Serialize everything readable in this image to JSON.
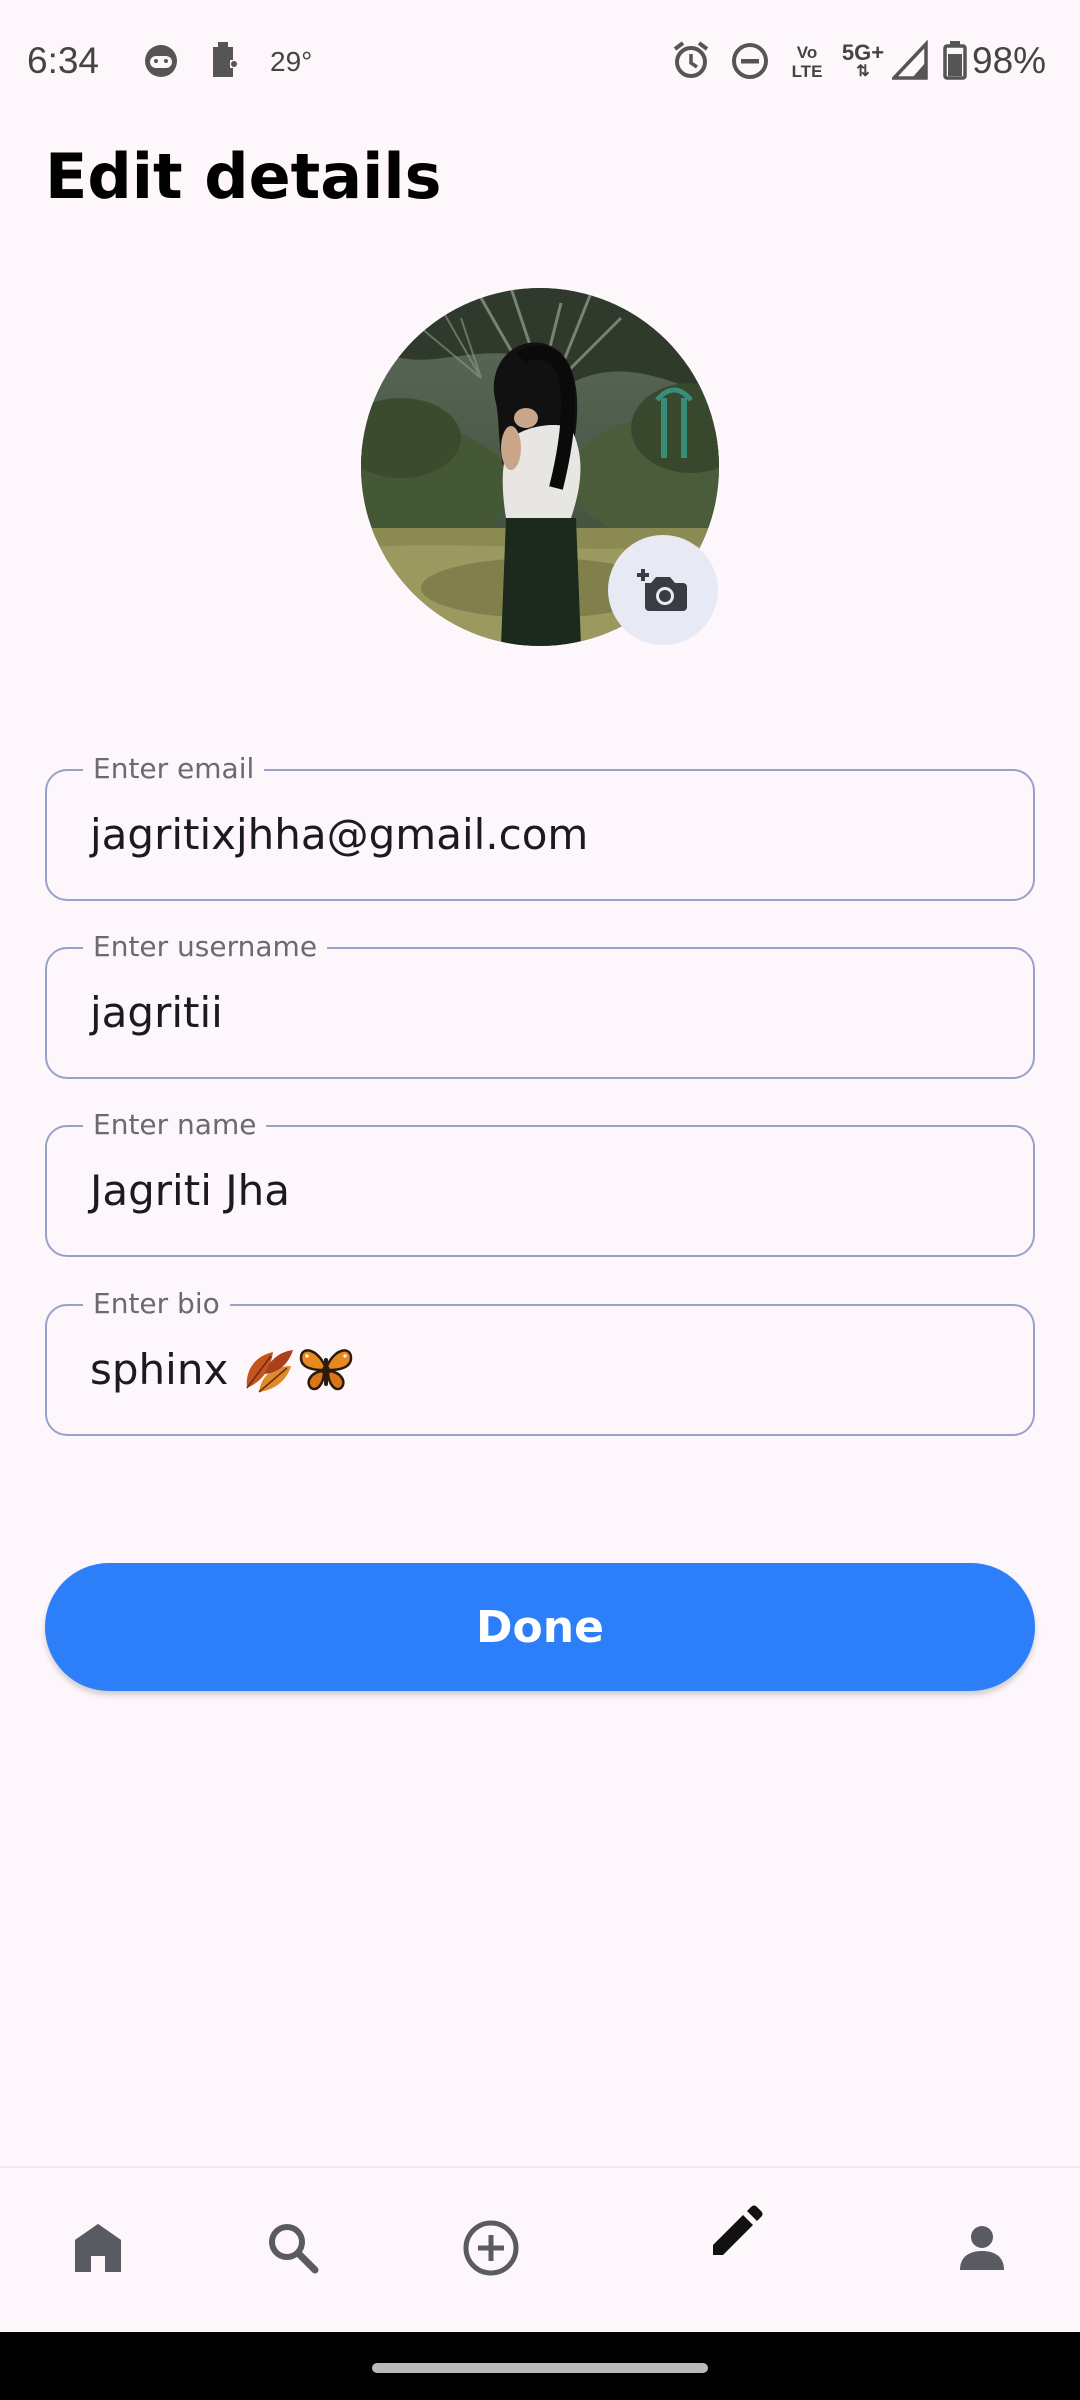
{
  "status_bar": {
    "time": "6:34",
    "temperature": "29°",
    "network_top": "Vo",
    "network_bottom": "LTE",
    "network_5g": "5G+",
    "battery": "98%"
  },
  "page": {
    "title": "Edit details"
  },
  "form": {
    "email": {
      "label": "Enter email",
      "value": "jagritixjhha@gmail.com"
    },
    "username": {
      "label": "Enter username",
      "value": "jagritii"
    },
    "name": {
      "label": "Enter name",
      "value": "Jagriti Jha"
    },
    "bio": {
      "label": "Enter bio",
      "value": "sphinx"
    }
  },
  "actions": {
    "done_label": "Done"
  },
  "bottom_nav": {
    "items": [
      "home-icon",
      "search-icon",
      "add-circle-icon",
      "edit-pencil-icon",
      "person-icon"
    ],
    "active": "edit-pencil-icon"
  },
  "colors": {
    "background": "#fdf7fc",
    "accent": "#2d7ff9",
    "field_border": "#98a2c9"
  }
}
